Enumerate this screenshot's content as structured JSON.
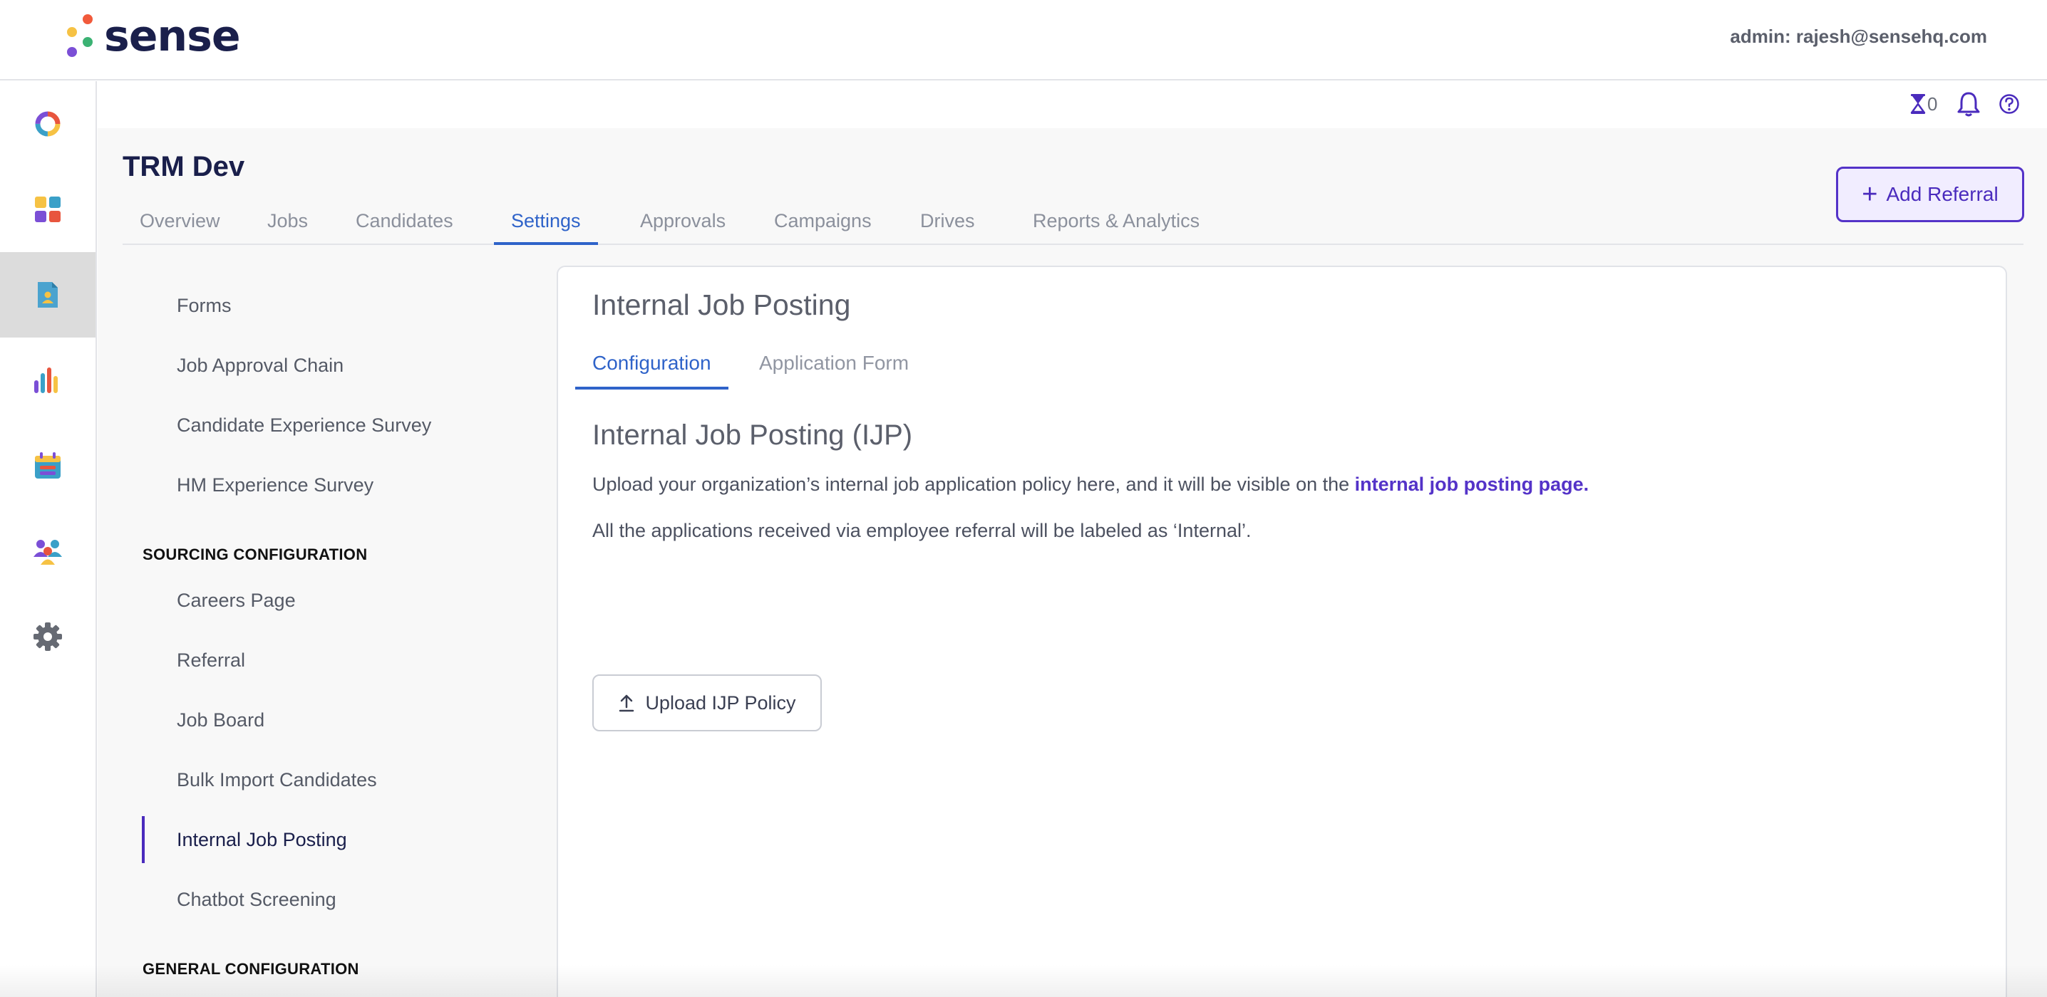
{
  "header": {
    "logo_text": "sense",
    "logo_dot_colors": [
      "#f15a3b",
      "#f6c244",
      "#3bb273",
      "#7b4fd6"
    ],
    "admin_label": "admin: rajesh@sensehq.com"
  },
  "rail": {
    "items": [
      {
        "name": "dashboard",
        "icon": "donut-icon"
      },
      {
        "name": "apps",
        "icon": "grid-icon"
      },
      {
        "name": "trm",
        "icon": "document-person-icon",
        "active": true
      },
      {
        "name": "analytics",
        "icon": "bar-chart-icon"
      },
      {
        "name": "calendar",
        "icon": "calendar-icon"
      },
      {
        "name": "people",
        "icon": "people-icon"
      },
      {
        "name": "settings",
        "icon": "gear-icon"
      }
    ]
  },
  "utility": {
    "hourglass_count": "0",
    "icons": [
      "hourglass-icon",
      "bell-icon",
      "help-icon"
    ]
  },
  "page": {
    "title": "TRM Dev",
    "add_referral_label": "Add Referral",
    "tabs": [
      {
        "label": "Overview"
      },
      {
        "label": "Jobs"
      },
      {
        "label": "Candidates"
      },
      {
        "label": "Settings",
        "active": true
      },
      {
        "label": "Approvals"
      },
      {
        "label": "Campaigns"
      },
      {
        "label": "Drives"
      },
      {
        "label": "Reports & Analytics"
      }
    ]
  },
  "sidebar": {
    "items_top": [
      {
        "label": "Forms"
      },
      {
        "label": "Job Approval Chain"
      },
      {
        "label": "Candidate Experience Survey"
      },
      {
        "label": "HM Experience Survey"
      }
    ],
    "section_sourcing": "SOURCING CONFIGURATION",
    "items_sourcing": [
      {
        "label": "Careers Page"
      },
      {
        "label": "Referral"
      },
      {
        "label": "Job Board"
      },
      {
        "label": "Bulk Import Candidates"
      },
      {
        "label": "Internal Job Posting",
        "active": true
      },
      {
        "label": "Chatbot Screening"
      }
    ],
    "section_general": "GENERAL CONFIGURATION"
  },
  "panel": {
    "title": "Internal Job Posting",
    "subtabs": [
      {
        "label": "Configuration",
        "active": true
      },
      {
        "label": "Application Form"
      }
    ],
    "heading": "Internal Job Posting (IJP)",
    "para1_text": "Upload your organization’s internal job application policy here, and it will be visible on the ",
    "para1_link": "internal job posting page.",
    "para2": "All the applications received via employee referral will be labeled as ‘Internal’.",
    "upload_label": "Upload IJP Policy"
  },
  "colors": {
    "accent_blue": "#2f63c9",
    "accent_purple": "#5433c8",
    "title_navy": "#1a1f4b"
  }
}
